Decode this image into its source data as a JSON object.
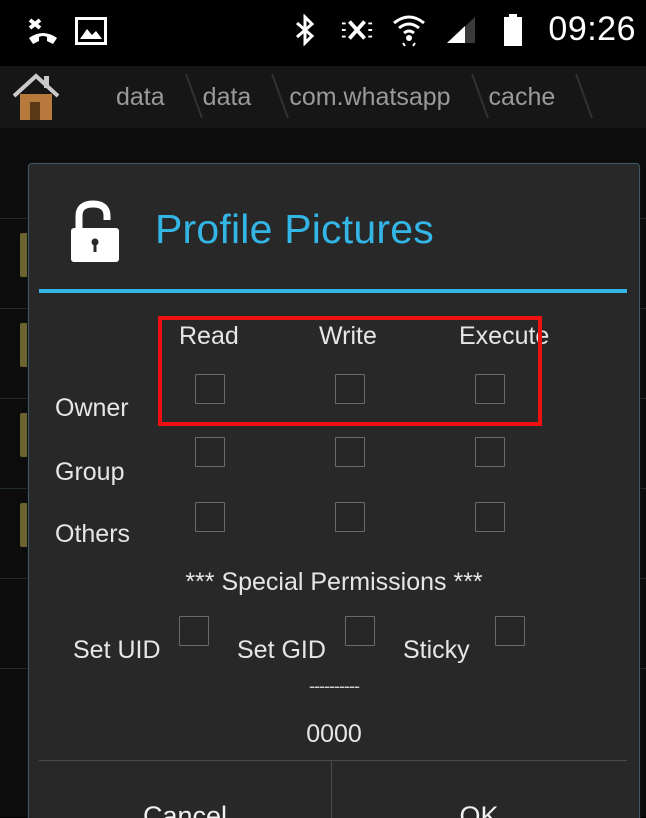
{
  "status_bar": {
    "time": "09:26",
    "icons": [
      "missed-call-icon",
      "image-icon",
      "bluetooth-icon",
      "mute-icon",
      "wifi-icon",
      "signal-icon",
      "battery-icon"
    ]
  },
  "breadcrumb": {
    "home_icon": "home-icon",
    "items": [
      "data",
      "data",
      "com.whatsapp",
      "cache"
    ]
  },
  "dialog": {
    "icon": "unlock-icon",
    "title": "Profile Pictures",
    "columns": [
      "Read",
      "Write",
      "Execute"
    ],
    "rows": [
      "Owner",
      "Group",
      "Others"
    ],
    "special_title": "*** Special Permissions ***",
    "special": [
      "Set UID",
      "Set GID",
      "Sticky"
    ],
    "dashes": "----------",
    "octal": "0000",
    "cancel_label": "Cancel",
    "ok_label": "OK"
  },
  "colors": {
    "accent": "#33b5e5",
    "dialog_bg": "#282828",
    "highlight": "#ee1111"
  }
}
